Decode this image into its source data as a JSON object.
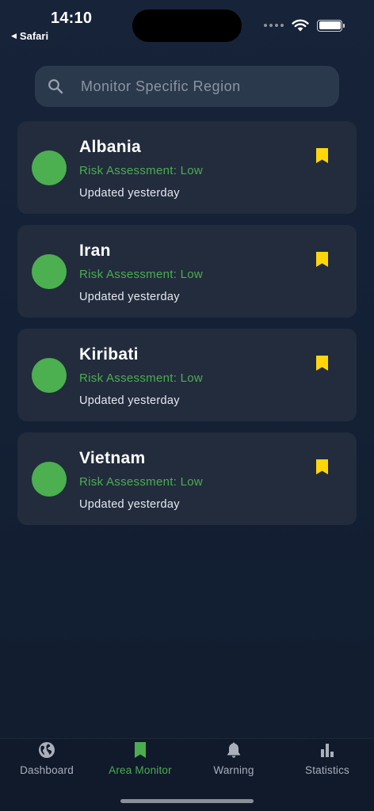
{
  "status_bar": {
    "time": "14:10",
    "back_label": "Safari",
    "back_arrow": "◀"
  },
  "search": {
    "placeholder": "Monitor Specific Region",
    "value": "",
    "icon": "search-icon"
  },
  "regions": [
    {
      "name": "Albania",
      "risk": "Risk Assessment: Low",
      "updated": "Updated yesterday",
      "status_color": "#4caf50",
      "bookmarked": true
    },
    {
      "name": "Iran",
      "risk": "Risk Assessment: Low",
      "updated": "Updated yesterday",
      "status_color": "#4caf50",
      "bookmarked": true
    },
    {
      "name": "Kiribati",
      "risk": "Risk Assessment: Low",
      "updated": "Updated yesterday",
      "status_color": "#4caf50",
      "bookmarked": true
    },
    {
      "name": "Vietnam",
      "risk": "Risk Assessment: Low",
      "updated": "Updated yesterday",
      "status_color": "#4caf50",
      "bookmarked": true
    }
  ],
  "tabs": [
    {
      "label": "Dashboard",
      "icon": "globe-icon",
      "active": false
    },
    {
      "label": "Area Monitor",
      "icon": "bookmark-icon",
      "active": true
    },
    {
      "label": "Warning",
      "icon": "bell-icon",
      "active": false
    },
    {
      "label": "Statistics",
      "icon": "bar-chart-icon",
      "active": false
    }
  ],
  "colors": {
    "background": "#131f33",
    "card": "#222c3d",
    "accent_green": "#4cad50",
    "bookmark_yellow": "#ffd60a",
    "inactive_tab": "#a9b0bb"
  }
}
